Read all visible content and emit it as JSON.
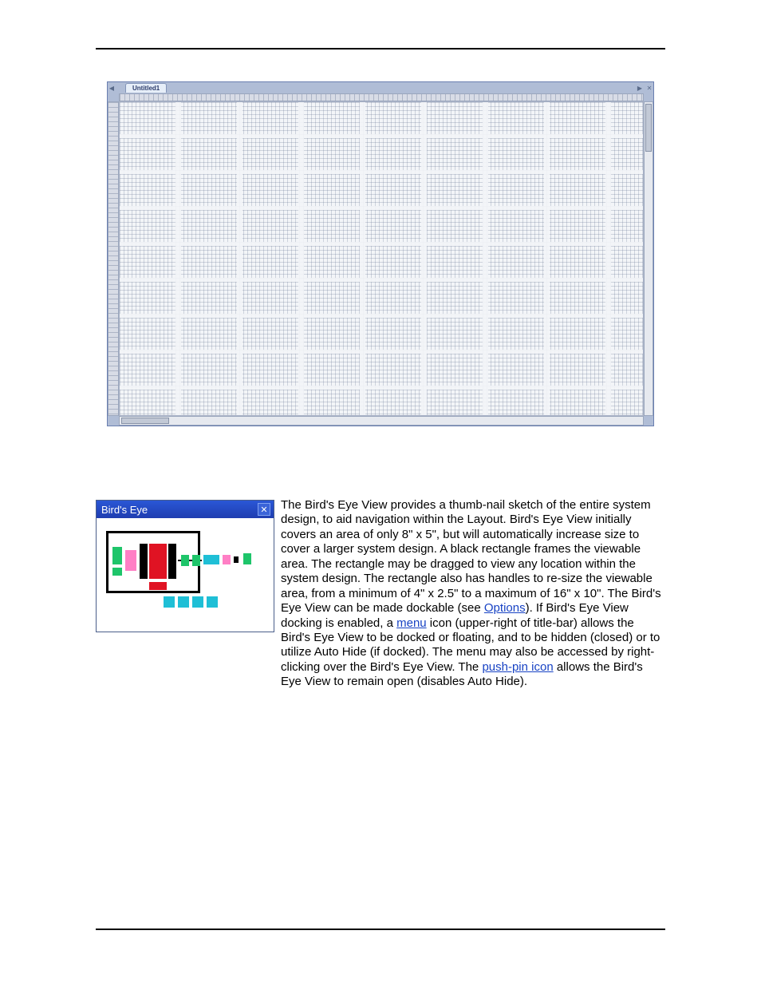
{
  "layout_window": {
    "tab_label": "Untitled1"
  },
  "birdseye_window": {
    "title": "Bird's Eye"
  },
  "paragraph": {
    "t1": "The Bird's Eye View provides a thumb-nail sketch of the entire system design, to aid navigation within the Layout. Bird's Eye View initially covers an area of only 8\" x 5\", but will automatically increase size to cover a larger system design. A black rectangle frames the viewable area. The rectangle may be dragged to view any location within the system design. The rectangle also has handles to re-size the viewable area, from a minimum of 4\" x 2.5\" to a maximum of 16\" x 10\". The Bird's Eye View can be made dockable (see ",
    "link1": "Options",
    "t2": "). If Bird's Eye View docking is enabled, a ",
    "link2": "menu",
    "t3": " icon (upper-right of title-bar) allows the Bird's Eye View to be docked or floating, and to be hidden (closed) or to utilize Auto Hide (if docked). The menu may also be accessed by right-clicking over the Bird's Eye View. The ",
    "link3": "push-pin icon",
    "t4": " allows the Bird's Eye View to remain open (disables Auto Hide)."
  }
}
